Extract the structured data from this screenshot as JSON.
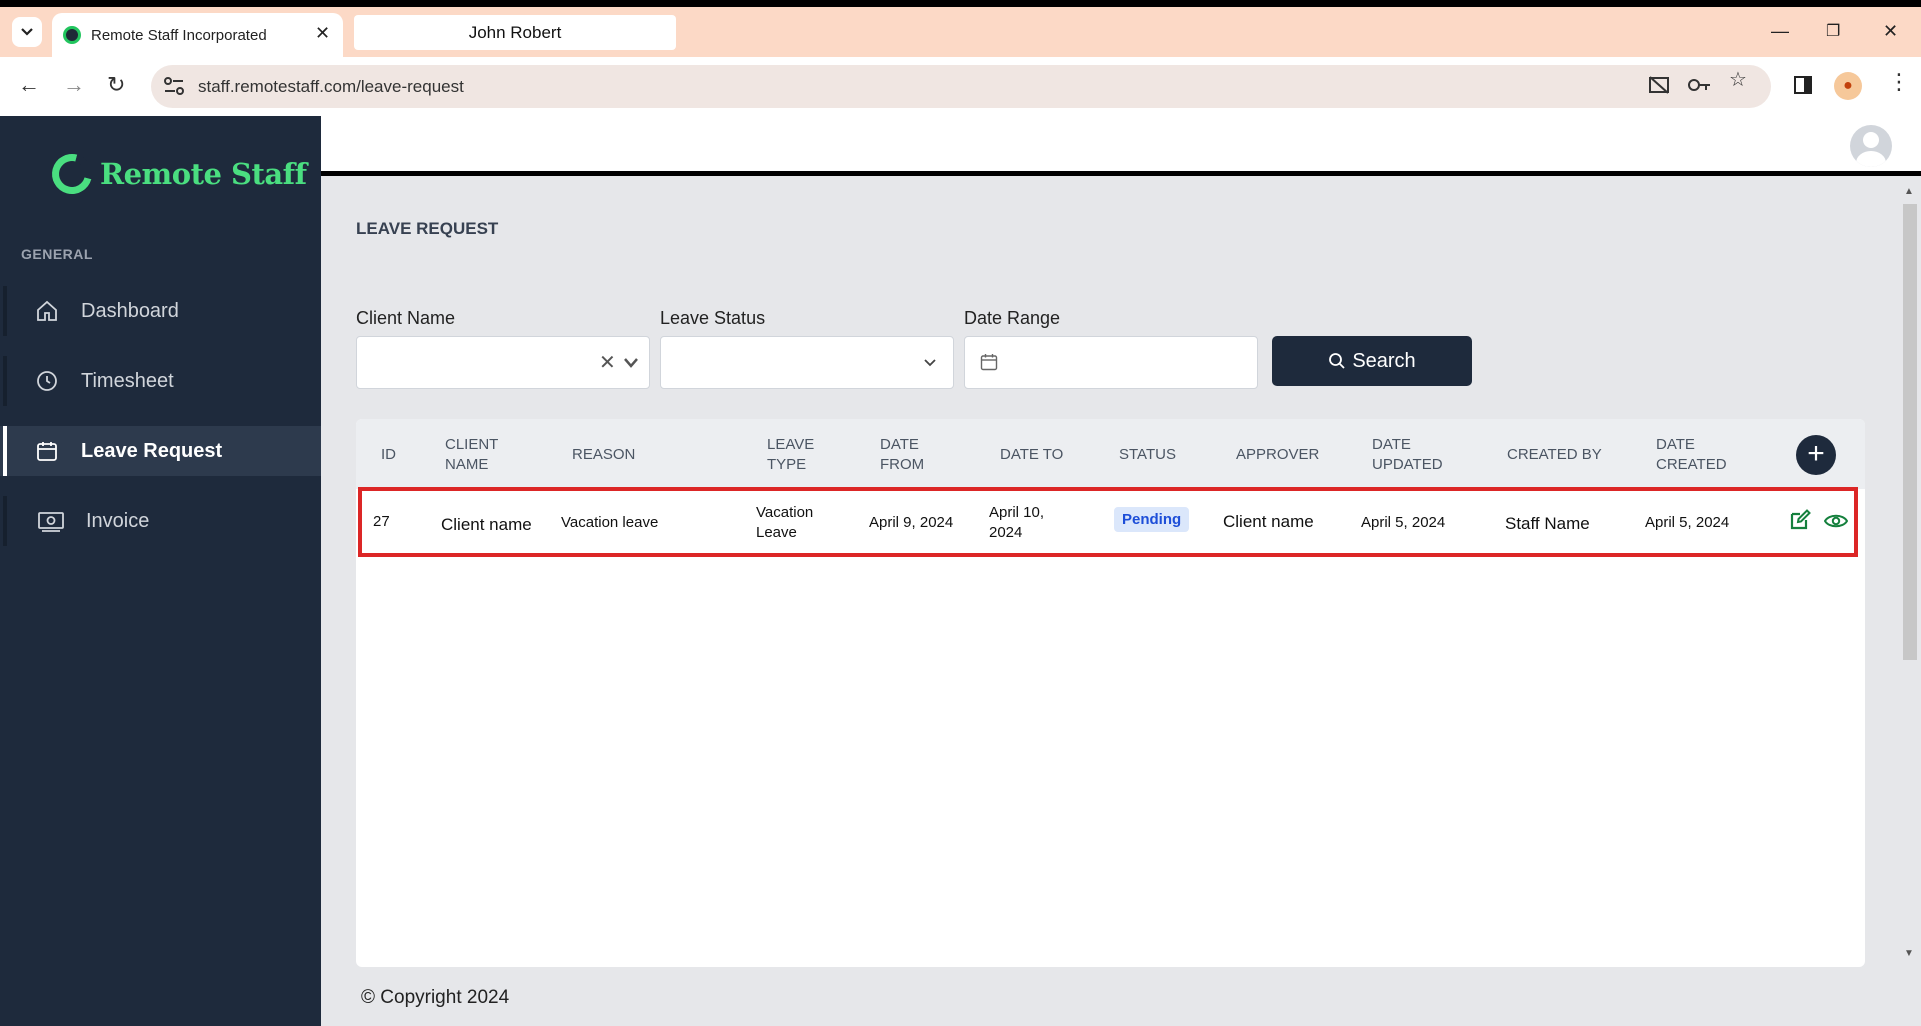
{
  "browser": {
    "tab_title": "Remote Staff Incorporated",
    "tab2_title": "John Robert",
    "url": "staff.remotestaff.com/leave-request"
  },
  "sidebar": {
    "logo_text": "Remote Staff",
    "section": "GENERAL",
    "items": [
      {
        "label": "Dashboard",
        "icon": "home-icon"
      },
      {
        "label": "Timesheet",
        "icon": "clock-icon"
      },
      {
        "label": "Leave Request",
        "icon": "calendar-icon",
        "active": true
      },
      {
        "label": "Invoice",
        "icon": "invoice-icon"
      }
    ]
  },
  "page": {
    "title": "LEAVE REQUEST"
  },
  "filters": {
    "client_name_label": "Client Name",
    "leave_status_label": "Leave Status",
    "date_range_label": "Date Range",
    "search_label": "Search"
  },
  "table": {
    "headers": {
      "id": "ID",
      "client_name_1": "CLIENT",
      "client_name_2": "NAME",
      "reason": "REASON",
      "leave_type_1": "LEAVE",
      "leave_type_2": "TYPE",
      "date_from_1": "DATE",
      "date_from_2": "FROM",
      "date_to": "DATE TO",
      "status": "STATUS",
      "approver": "APPROVER",
      "date_updated_1": "DATE",
      "date_updated_2": "UPDATED",
      "created_by": "CREATED BY",
      "date_created_1": "DATE",
      "date_created_2": "CREATED"
    },
    "rows": [
      {
        "id": "27",
        "client_name": "Client name",
        "reason": "Vacation leave",
        "leave_type_1": "Vacation",
        "leave_type_2": "Leave",
        "date_from": "April 9, 2024",
        "date_to_1": "April 10,",
        "date_to_2": "2024",
        "status": "Pending",
        "approver": "Client name",
        "date_updated": "April 5, 2024",
        "created_by": "Staff Name",
        "date_created": "April 5, 2024"
      }
    ]
  },
  "footer": {
    "copyright": "© Copyright 2024"
  },
  "colors": {
    "sidebar_bg": "#1e2a3c",
    "brand_green": "#4ade80",
    "highlight_border": "#dc2626",
    "pending_badge": "#dbe7fb"
  }
}
